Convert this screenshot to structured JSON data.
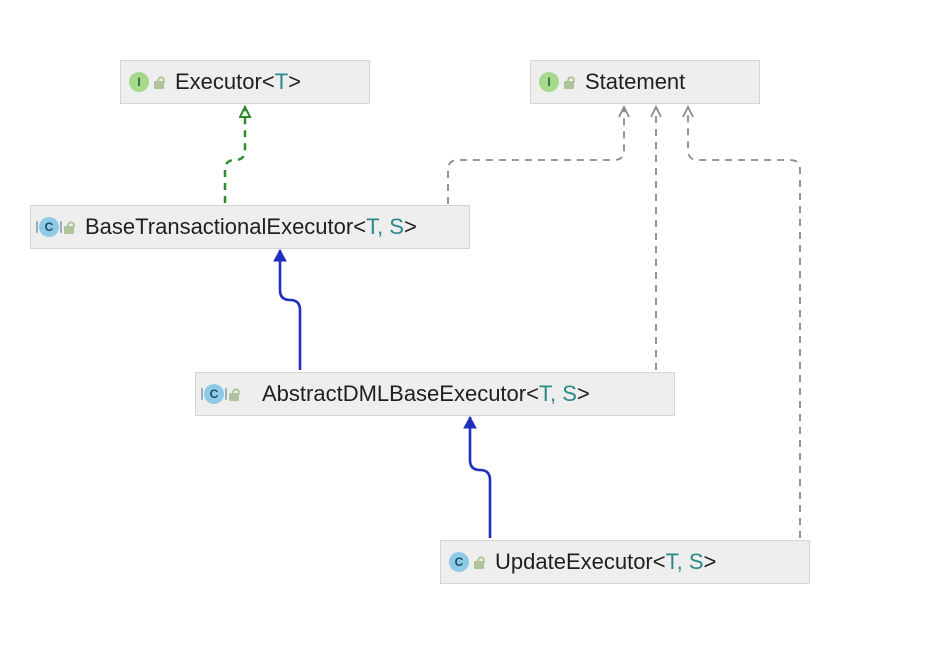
{
  "colors": {
    "implements": "#2e8b2e",
    "extends": "#1f2fbf",
    "uses": "#8a8a8a",
    "node_bg": "#eeeeee"
  },
  "nodes": {
    "executor": {
      "kind": "interface",
      "badge_letter": "I",
      "name_plain": "Executor",
      "type_params": "T"
    },
    "statement": {
      "kind": "interface",
      "badge_letter": "I",
      "name_plain": "Statement",
      "type_params": ""
    },
    "base_txn": {
      "kind": "abstract",
      "badge_letter": "C",
      "name_plain": "BaseTransactionalExecutor",
      "type_params": "T, S"
    },
    "abstract_dml": {
      "kind": "abstract",
      "badge_letter": "C",
      "name_plain": "AbstractDMLBaseExecutor",
      "type_params": "T, S"
    },
    "update_exec": {
      "kind": "class",
      "badge_letter": "C",
      "name_plain": "UpdateExecutor",
      "type_params": "T, S"
    }
  }
}
